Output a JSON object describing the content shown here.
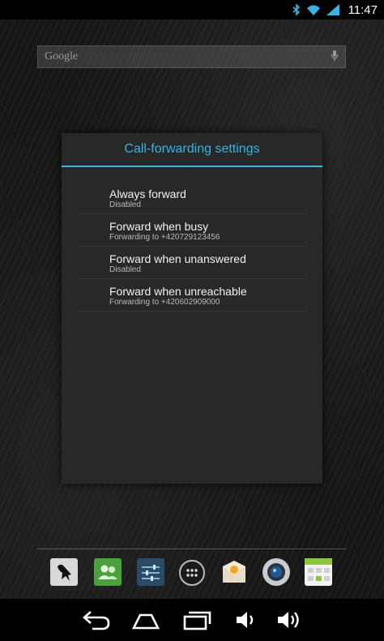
{
  "status_bar": {
    "time": "11:47"
  },
  "search": {
    "text": "Google"
  },
  "dialog": {
    "title": "Call-forwarding settings",
    "items": [
      {
        "title": "Always forward",
        "subtitle": "Disabled"
      },
      {
        "title": "Forward when busy",
        "subtitle": "Forwarding to +420729123456"
      },
      {
        "title": "Forward when unanswered",
        "subtitle": "Disabled"
      },
      {
        "title": "Forward when unreachable",
        "subtitle": "Forwarding to +420602909000"
      }
    ]
  },
  "colors": {
    "accent": "#33b5e5",
    "dialog_bg": "#282828"
  },
  "dock_apps": [
    "raven-app-icon",
    "contacts-icon",
    "settings-icon",
    "app-drawer-icon",
    "email-icon",
    "camera-icon",
    "calendar-icon"
  ],
  "nav_buttons": [
    "back-icon",
    "home-icon",
    "recent-apps-icon",
    "volume-down-icon",
    "volume-up-icon"
  ]
}
